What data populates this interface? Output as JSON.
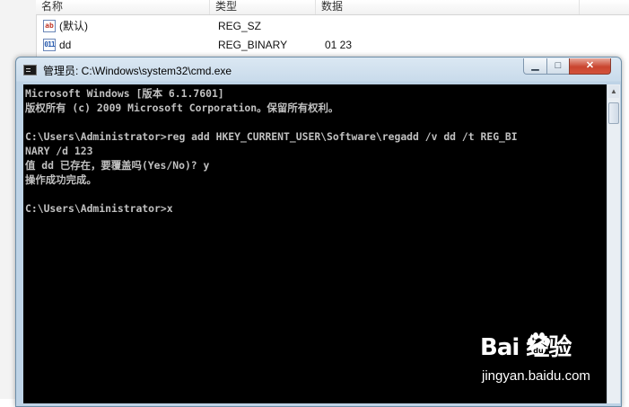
{
  "registry": {
    "columns": [
      "名称",
      "类型",
      "数据"
    ],
    "rows": [
      {
        "icon": "string-value-icon",
        "icon_glyph": "ab",
        "name": "(默认)",
        "type": "REG_SZ",
        "data": ""
      },
      {
        "icon": "binary-value-icon",
        "icon_glyph": "011",
        "name": "dd",
        "type": "REG_BINARY",
        "data": "01 23"
      }
    ]
  },
  "cmd": {
    "title": "管理员: C:\\Windows\\system32\\cmd.exe",
    "buttons": {
      "minimize": "▁",
      "maximize": "□",
      "close": "✕"
    },
    "lines": [
      "Microsoft Windows [版本 6.1.7601]",
      "版权所有 (c) 2009 Microsoft Corporation。保留所有权利。",
      "",
      "C:\\Users\\Administrator>reg add HKEY_CURRENT_USER\\Software\\regadd /v dd /t REG_BI",
      "NARY /d 123",
      "值 dd 已存在，要覆盖吗(Yes/No)? y",
      "操作成功完成。",
      "",
      "C:\\Users\\Administrator>x"
    ],
    "colors": {
      "background": "#000000",
      "text": "#c0c0c0"
    }
  },
  "watermark": {
    "logo": "Bai  经验",
    "url": "jingyan.baidu.com"
  }
}
